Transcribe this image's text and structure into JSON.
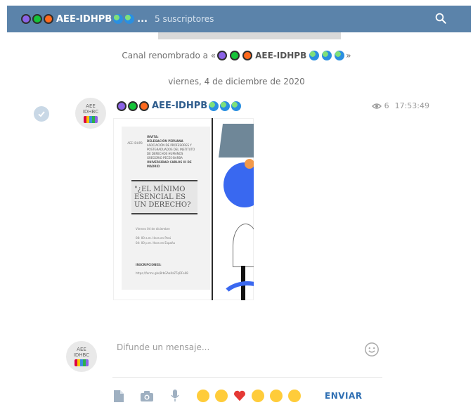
{
  "header": {
    "channel_name": "AEE-IDHPB",
    "ellipsis": "...",
    "subscribers": "5 suscriptores"
  },
  "service": {
    "rename_prefix": "Canal renombrado a «",
    "rename_name": "AEE-IDHPB",
    "rename_suffix": "»",
    "date": "viernes, 4 de diciembre de 2020"
  },
  "message": {
    "author": "AEE-IDHPB",
    "views": "6",
    "time": "17:53:49",
    "avatar_text_1": "AEE",
    "avatar_text_2": "IDHBC"
  },
  "flyer": {
    "invite_line": "INVITA:",
    "org_lines": [
      "DELEGACIÓN PERUANA",
      "ASOCIACIÓN DE PROFESORES Y",
      "POSTGRADUADOS DEL INSTITUTO",
      "DE DERECHOS HUMANOS",
      "GREGORIO PECES-BARBA",
      "UNIVERSIDAD CARLOS III DE",
      "MADRID"
    ],
    "title": "\"¿EL MÍNIMO ESENCIAL ES UN DERECHO?",
    "date_line": "Viernes 04 de diciembre",
    "time_1": "08: 00 a.m. Hora en Perú",
    "time_2": "04: 00 p.m. Hora en España",
    "inscriptions": "INSCRIPCIONES:",
    "link": "https://forms.gle/8rbGAaKzZTqDFe68",
    "logo_text": "AEE IDHPB"
  },
  "composer": {
    "placeholder": "Difunde un mensaje...",
    "send_label": "ENVIAR",
    "avatar_text_1": "AEE",
    "avatar_text_2": "IDHBC"
  },
  "colors": {
    "header_bg": "#5b83aa",
    "accent": "#2f6fb3"
  },
  "icons": {
    "search": "search-icon",
    "check": "check-circle-icon",
    "views": "eye-icon",
    "smile": "smile-icon",
    "file": "file-icon",
    "camera": "camera-icon",
    "mic": "microphone-icon"
  }
}
